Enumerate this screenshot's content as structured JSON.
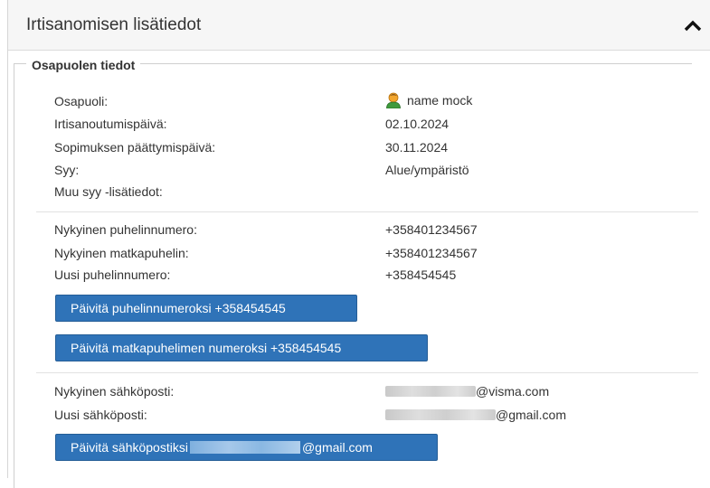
{
  "panel": {
    "title": "Irtisanomisen lisätiedot",
    "section_title": "Osapuolen tiedot"
  },
  "party": {
    "osapuoli_label": "Osapuoli:",
    "osapuoli_value": "name mock",
    "irtisanoutumispaiva_label": "Irtisanoutumispäivä:",
    "irtisanoutumispaiva_value": "02.10.2024",
    "paattymispaiva_label": "Sopimuksen päättymispäivä:",
    "paattymispaiva_value": "30.11.2024",
    "syy_label": "Syy:",
    "syy_value": "Alue/ympäristö",
    "muu_syy_label": "Muu syy -lisätiedot:"
  },
  "phone": {
    "current_phone_label": "Nykyinen puhelinnumero:",
    "current_phone_value": "+358401234567",
    "current_mobile_label": "Nykyinen matkapuhelin:",
    "current_mobile_value": "+358401234567",
    "new_phone_label": "Uusi puhelinnumero:",
    "new_phone_value": "+358454545",
    "update_phone_button": "Päivitä puhelinnumeroksi +358454545",
    "update_mobile_button": "Päivitä matkapuhelimen numeroksi +358454545"
  },
  "email": {
    "current_email_label": "Nykyinen sähköposti:",
    "current_email_domain": "@visma.com",
    "new_email_label": "Uusi sähköposti:",
    "new_email_domain": "@gmail.com",
    "update_email_button_prefix": "Päivitä sähköpostiksi",
    "update_email_button_suffix": "@gmail.com"
  },
  "icons": {
    "collapse": "chevron-up-icon",
    "party": "user-avatar-icon"
  },
  "colors": {
    "button_bg": "#2f73b8",
    "header_bg": "#f6f6f6"
  }
}
